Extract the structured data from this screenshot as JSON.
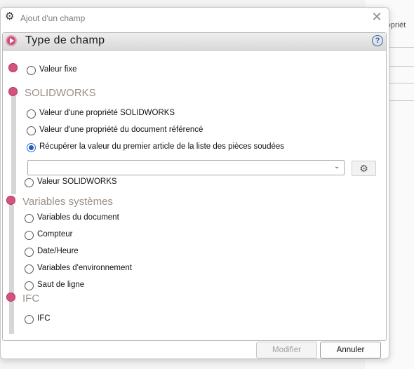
{
  "background_window": {
    "tab_label": "ropriét"
  },
  "dialog": {
    "title": "Ajout d'un champ",
    "title_icon": "gear-icon",
    "close_glyph": "✕"
  },
  "panel": {
    "header": "Type de champ",
    "help_glyph": "?"
  },
  "options": {
    "fixed": "Valeur fixe",
    "solidworks_section": "SOLIDWORKS",
    "sw_property": "Valeur d'une propriété SOLIDWORKS",
    "ref_doc_property": "Valeur d'une propriété du document référencé",
    "weldment_value": "Récupérer la valeur du premier article de la liste des pièces soudées",
    "combo_value": "",
    "sw_value": "Valeur SOLIDWORKS",
    "system_section": "Variables systèmes",
    "doc_vars": "Variables du document",
    "counter": "Compteur",
    "datetime": "Date/Heure",
    "env_vars": "Variables d'environnement",
    "line_break": "Saut de ligne",
    "ifc_section": "IFC",
    "ifc": "IFC"
  },
  "selected_option": "weldment_value",
  "buttons": {
    "modify": "Modifier",
    "cancel": "Annuler"
  },
  "colors": {
    "accent": "#d4527e",
    "selected_radio": "#1f5fbd"
  }
}
